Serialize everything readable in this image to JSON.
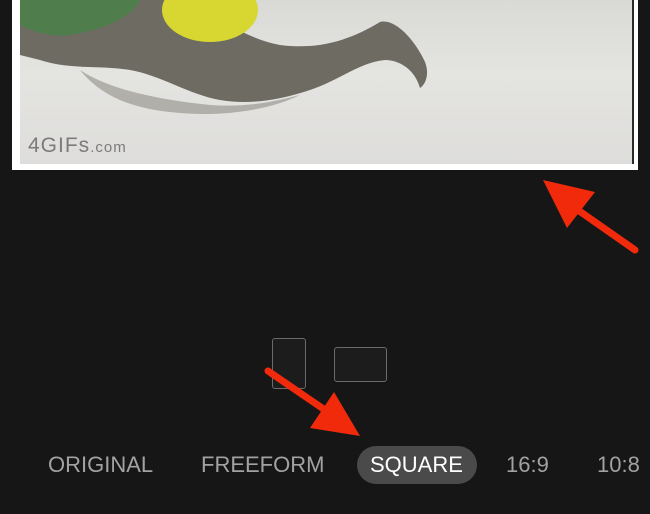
{
  "photo": {
    "watermark_main": "4GIFs",
    "watermark_suffix": ".com"
  },
  "aspect_orientation": {
    "portrait_icon": "portrait-aspect-icon",
    "landscape_icon": "landscape-aspect-icon"
  },
  "ratios": [
    {
      "label": "ORIGINAL",
      "selected": false
    },
    {
      "label": "FREEFORM",
      "selected": false
    },
    {
      "label": "SQUARE",
      "selected": true
    },
    {
      "label": "16:9",
      "selected": false
    },
    {
      "label": "10:8",
      "selected": false
    }
  ],
  "colors": {
    "background": "#161616",
    "selected_pill": "#4a4a4a",
    "annotation_arrow": "#f22a0c"
  }
}
